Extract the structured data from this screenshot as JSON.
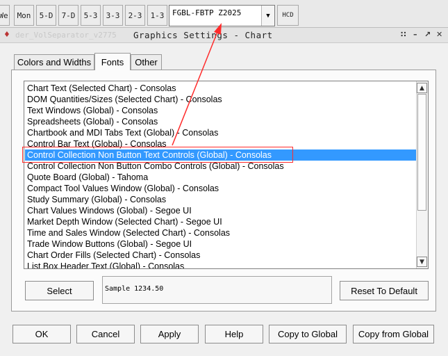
{
  "toolbar": {
    "buttons": [
      "We",
      "Mon",
      "5-D",
      "7-D",
      "5-3",
      "3-3",
      "2-3",
      "1-3"
    ],
    "symbol_value": "FGBL-FBTP Z2025",
    "hcd_label": "HCD"
  },
  "window": {
    "ghost_title": "der_VolSeparator_v2775",
    "title": "Graphics Settings  - Chart"
  },
  "tabs": [
    "Colors and Widths",
    "Fonts",
    "Other"
  ],
  "font_list": {
    "items": [
      "Chart Text (Selected Chart) - Consolas",
      "DOM Quantities/Sizes (Selected Chart) - Consolas",
      "Text Windows (Global) - Consolas",
      "Spreadsheets (Global) - Consolas",
      "Chartbook and MDI Tabs Text (Global) - Consolas",
      "Control Bar Text (Global) - Consolas",
      "Control Collection Non Button Text Controls (Global) - Consolas",
      "Control Collection Non Button Combo Controls (Global) - Consolas",
      "Quote Board (Global) - Tahoma",
      "Compact Tool Values Window (Global) - Consolas",
      "Study Summary (Global) - Consolas",
      "Chart Values Windows (Global) - Segoe UI",
      "Market Depth Window (Selected Chart) - Segoe UI",
      "Time and Sales Window (Selected Chart) - Consolas",
      "Trade Window Buttons (Global) - Segoe UI",
      "Chart Order Fills (Selected Chart) - Consolas",
      "List Box Header Text (Global) - Consolas"
    ]
  },
  "select_label": "Select",
  "sample_text": "Sample 1234.50",
  "reset_label": "Reset To Default",
  "bottom_buttons": [
    "OK",
    "Cancel",
    "Apply",
    "Help",
    "Copy to Global",
    "Copy from Global"
  ],
  "colors": {
    "selection": "#3399ff",
    "annotation": "#ff2b2b"
  }
}
